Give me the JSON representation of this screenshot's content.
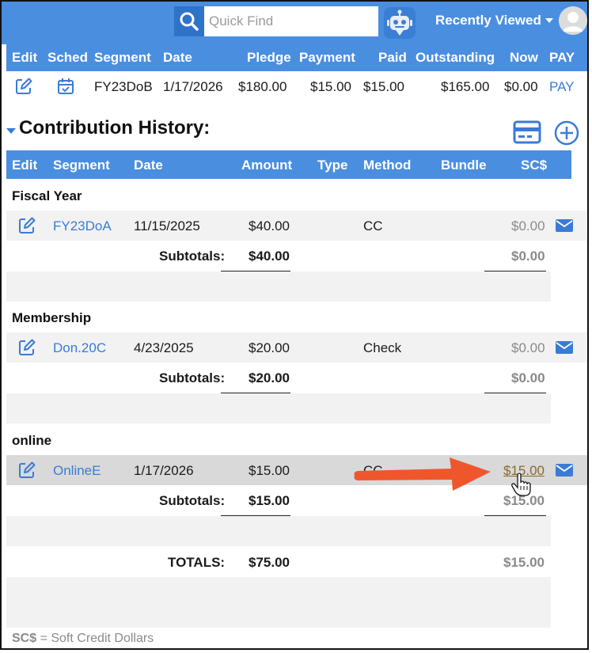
{
  "topbar": {
    "search_placeholder": "Quick Find",
    "recently_viewed": "Recently Viewed",
    "icons": [
      "search-icon",
      "robot-icon",
      "chevron-down-icon",
      "avatar"
    ]
  },
  "pledge_table": {
    "headers": [
      "Edit",
      "Sched",
      "Segment",
      "Date",
      "Pledge",
      "Payment",
      "Paid",
      "Outstanding",
      "Now",
      "PAY"
    ],
    "row": {
      "segment": "FY23DoB",
      "date": "1/17/2026",
      "pledge": "$180.00",
      "payment": "$15.00",
      "paid": "$15.00",
      "outstanding": "$165.00",
      "now": "$0.00",
      "pay": "PAY"
    }
  },
  "contribution_history": {
    "title": "Contribution History:",
    "headers": [
      "Edit",
      "Segment",
      "Date",
      "Amount",
      "Type",
      "Method",
      "Bundle",
      "SC$"
    ],
    "subtotals_label": "Subtotals:",
    "groups": [
      {
        "label": "Fiscal Year",
        "rows": [
          {
            "segment": "FY23DoA",
            "date": "11/15/2025",
            "amount": "$40.00",
            "method": "CC",
            "sc": "$0.00"
          }
        ],
        "subtotal_amount": "$40.00",
        "subtotal_sc": "$0.00"
      },
      {
        "label": "Membership",
        "rows": [
          {
            "segment": "Don.20C",
            "date": "4/23/2025",
            "amount": "$20.00",
            "method": "Check",
            "sc": "$0.00"
          }
        ],
        "subtotal_amount": "$20.00",
        "subtotal_sc": "$0.00"
      },
      {
        "label": "online",
        "rows": [
          {
            "segment": "OnlineE",
            "date": "1/17/2026",
            "amount": "$15.00",
            "method": "CC",
            "sc": "$15.00"
          }
        ],
        "subtotal_amount": "$15.00",
        "subtotal_sc": "$15.00"
      }
    ],
    "totals_label": "TOTALS:",
    "totals_amount": "$75.00",
    "totals_sc": "$15.00"
  },
  "footnote": {
    "abbr": "SC$",
    "text": " = Soft Credit Dollars"
  },
  "colors": {
    "header_blue": "#4a8ee0",
    "link_blue": "#3a7bd5",
    "arrow_orange": "#f0562c"
  }
}
